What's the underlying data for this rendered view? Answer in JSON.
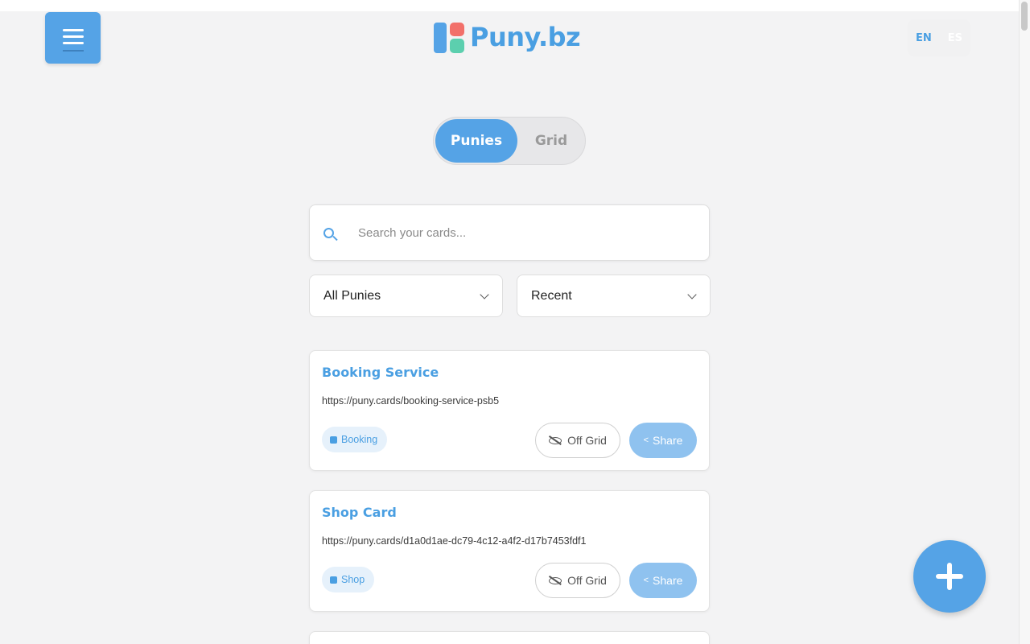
{
  "header": {
    "menu_icon": "hamburger-icon",
    "logo_text": "Puny.bz",
    "languages": [
      {
        "code": "EN",
        "active": true
      },
      {
        "code": "ES",
        "active": false
      }
    ]
  },
  "view_toggle": {
    "options": [
      {
        "label": "Punies",
        "active": true
      },
      {
        "label": "Grid",
        "active": false
      }
    ]
  },
  "search": {
    "placeholder": "Search your cards...",
    "value": "",
    "icon": "search-icon"
  },
  "filters": {
    "category": {
      "selected": "All Punies"
    },
    "sort": {
      "selected": "Recent"
    }
  },
  "cards": [
    {
      "title": "Booking Service",
      "url": "https://puny.cards/booking-service-psb5",
      "tag": "Booking",
      "tag_icon": "calendar-icon",
      "off_grid_label": "Off Grid",
      "share_label": "Share"
    },
    {
      "title": "Shop Card",
      "url": "https://puny.cards/d1a0d1ae-dc79-4c12-a4f2-d17b7453fdf1",
      "tag": "Shop",
      "tag_icon": "shopping-bag-icon",
      "off_grid_label": "Off Grid",
      "share_label": "Share"
    }
  ],
  "fab": {
    "icon": "plus-icon"
  },
  "colors": {
    "accent": "#55a3e6",
    "accent_text": "#4a9fe2",
    "share_button": "#8fc2ef",
    "tag_background": "#e6f1fb",
    "page_background": "#f3f3f4",
    "logo_red": "#f2706a",
    "logo_green": "#5ccfae"
  }
}
